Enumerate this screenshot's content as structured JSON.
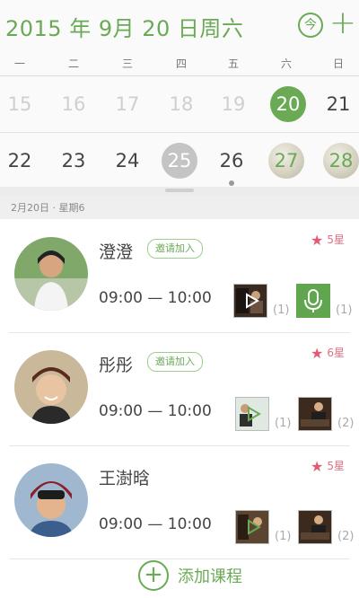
{
  "header": {
    "title": "2015 年 9月 20 日周六",
    "today_label": "今",
    "add_icon": "plus-icon"
  },
  "weekdays": [
    "一",
    "二",
    "三",
    "四",
    "五",
    "六",
    "日"
  ],
  "weeks": [
    [
      "15",
      "16",
      "17",
      "18",
      "19",
      "20",
      "21"
    ],
    [
      "22",
      "23",
      "24",
      "25",
      "26",
      "27",
      "28"
    ]
  ],
  "selected_day": "20",
  "date_strip": "2月20日 · 星期6",
  "students": [
    {
      "name": "澄澄",
      "invite_label": "邀请加入",
      "rating": "5星",
      "time": "09:00 — 10:00",
      "materials": [
        {
          "icon": "video-icon",
          "count": "(1)"
        },
        {
          "icon": "microphone-icon",
          "count": "(1)"
        }
      ]
    },
    {
      "name": "彤彤",
      "invite_label": "邀请加入",
      "rating": "6星",
      "time": "09:00 — 10:00",
      "materials": [
        {
          "icon": "video-icon",
          "count": "(1)"
        },
        {
          "icon": "photo-icon",
          "count": "(2)"
        }
      ]
    },
    {
      "name": "王澍晗",
      "rating": "5星",
      "time": "09:00 — 10:00",
      "materials": [
        {
          "icon": "video-icon",
          "count": "(1)"
        },
        {
          "icon": "photo-icon",
          "count": "(2)"
        }
      ]
    }
  ],
  "add_course_label": "添加课程",
  "colors": {
    "accent": "#6aaa55",
    "star": "#e35a74",
    "today_gray": "#c4c4c4"
  }
}
